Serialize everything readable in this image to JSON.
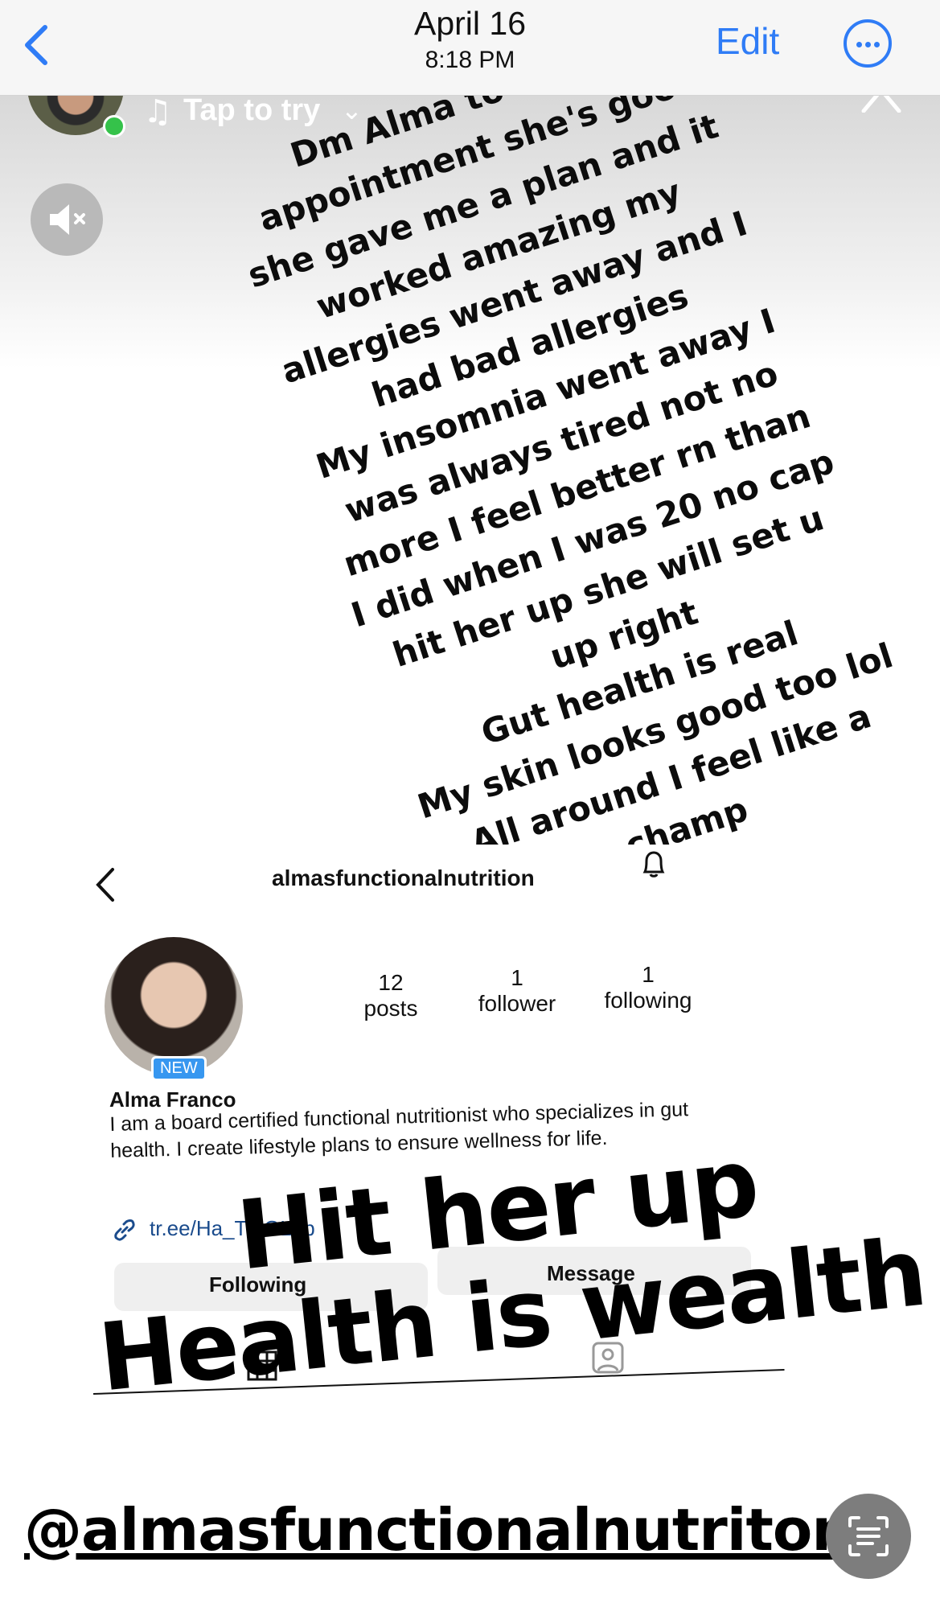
{
  "topbar": {
    "date": "April 16",
    "time": "8:18 PM",
    "edit_label": "Edit",
    "back_icon": "chevron-left-icon",
    "more_icon": "ellipsis-circle-icon",
    "accent_color": "#2f7cf6"
  },
  "story": {
    "music_label": "Tap to try",
    "caption_lines": [
      "Dm Alma to and s",
      "appointment she's goo",
      "she gave me a plan and it",
      "worked amazing my",
      "allergies went away and I",
      "had bad allergies",
      "My insomnia went away I",
      "was always tired not no",
      "more I feel better rn than",
      "I did when I was 20 no cap",
      "hit her up she will set u",
      "up right",
      "Gut health is real",
      "My skin looks good too lol",
      "All around I feel like a",
      "champ"
    ]
  },
  "profile": {
    "username": "almasfunctionalnutrition",
    "badge": "NEW",
    "stats": [
      {
        "num": "12",
        "label": "posts"
      },
      {
        "num": "1",
        "label": "follower"
      },
      {
        "num": "1",
        "label": "following"
      }
    ],
    "name": "Alma Franco",
    "bio": "I am a board certified functional nutritionist who specializes in gut health. I create lifestyle plans to ensure wellness for life.",
    "link": "tr.ee/Ha_TryGLob",
    "following_label": "Following",
    "message_label": "Message"
  },
  "overlay": {
    "line1": "Hit her up",
    "line2": "Health is wealth",
    "mention": "@almasfunctionalnutriton"
  }
}
